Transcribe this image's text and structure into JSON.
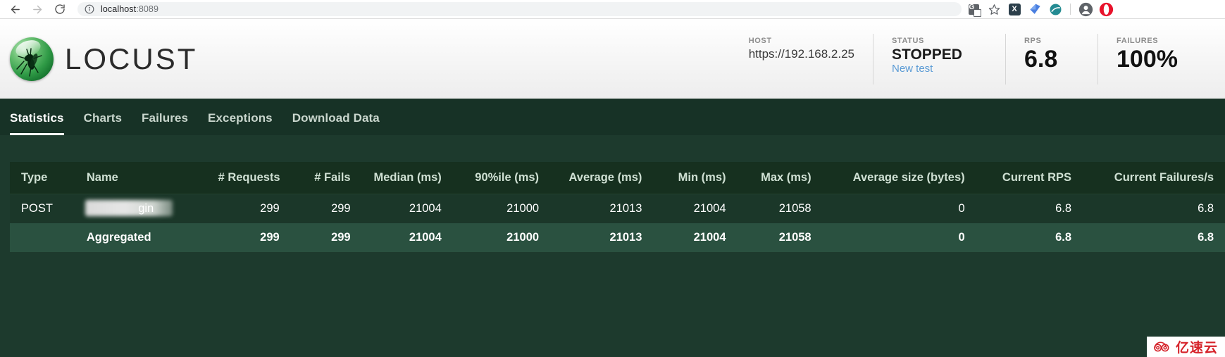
{
  "browser": {
    "back_icon": "arrow-left-icon",
    "forward_icon": "arrow-right-icon",
    "reload_icon": "reload-icon",
    "site_info_icon": "info-circle-icon",
    "url_host": "localhost",
    "url_port": ":8089",
    "url_full": "localhost:8089",
    "extensions": [
      {
        "name": "translate-icon",
        "label": "G"
      },
      {
        "name": "bookmark-star-icon",
        "label": "☆"
      },
      {
        "name": "xmind-extension-icon",
        "label": "X"
      },
      {
        "name": "kite-extension-icon",
        "label": ""
      },
      {
        "name": "idm-extension-icon",
        "label": ""
      },
      {
        "name": "profile-avatar-icon",
        "label": ""
      },
      {
        "name": "opera-extension-icon",
        "label": ""
      }
    ]
  },
  "header": {
    "brand": "LOCUST",
    "logo_icon": "locust-logo-icon",
    "stats": [
      {
        "label": "HOST",
        "value": "https://192.168.2.25",
        "link": null,
        "size": "host"
      },
      {
        "label": "STATUS",
        "value": "STOPPED",
        "link": "New test",
        "size": "big"
      },
      {
        "label": "RPS",
        "value": "6.8",
        "link": null,
        "size": "huge"
      },
      {
        "label": "FAILURES",
        "value": "100%",
        "link": null,
        "size": "big"
      }
    ]
  },
  "nav": {
    "tabs": [
      {
        "label": "Statistics",
        "active": true
      },
      {
        "label": "Charts",
        "active": false
      },
      {
        "label": "Failures",
        "active": false
      },
      {
        "label": "Exceptions",
        "active": false
      },
      {
        "label": "Download Data",
        "active": false
      }
    ]
  },
  "table": {
    "columns": [
      "Type",
      "Name",
      "# Requests",
      "# Fails",
      "Median (ms)",
      "90%ile (ms)",
      "Average (ms)",
      "Min (ms)",
      "Max (ms)",
      "Average size (bytes)",
      "Current RPS",
      "Current Failures/s"
    ],
    "rows": [
      {
        "type": "POST",
        "name_redacted": true,
        "name_visible_tail": "gin",
        "name": "gin",
        "requests": "299",
        "fails": "299",
        "median": "21004",
        "p90": "21000",
        "average": "21013",
        "min": "21004",
        "max": "21058",
        "avg_size": "0",
        "current_rps": "6.8",
        "current_failures": "6.8",
        "total": false
      },
      {
        "type": "",
        "name_redacted": false,
        "name": "Aggregated",
        "requests": "299",
        "fails": "299",
        "median": "21004",
        "p90": "21000",
        "average": "21013",
        "min": "21004",
        "max": "21058",
        "avg_size": "0",
        "current_rps": "6.8",
        "current_failures": "6.8",
        "total": true
      }
    ]
  },
  "watermark": {
    "text": "亿速云",
    "icon": "cloud-logo-icon"
  },
  "colors": {
    "page_bg": "#1d3a2d",
    "navbar_bg": "#173226",
    "table_header_bg": "#16301f",
    "row_bg": "#1b3729",
    "total_row_bg": "#2a5140",
    "link": "#5b9bd5",
    "watermark_red": "#d6242b"
  }
}
